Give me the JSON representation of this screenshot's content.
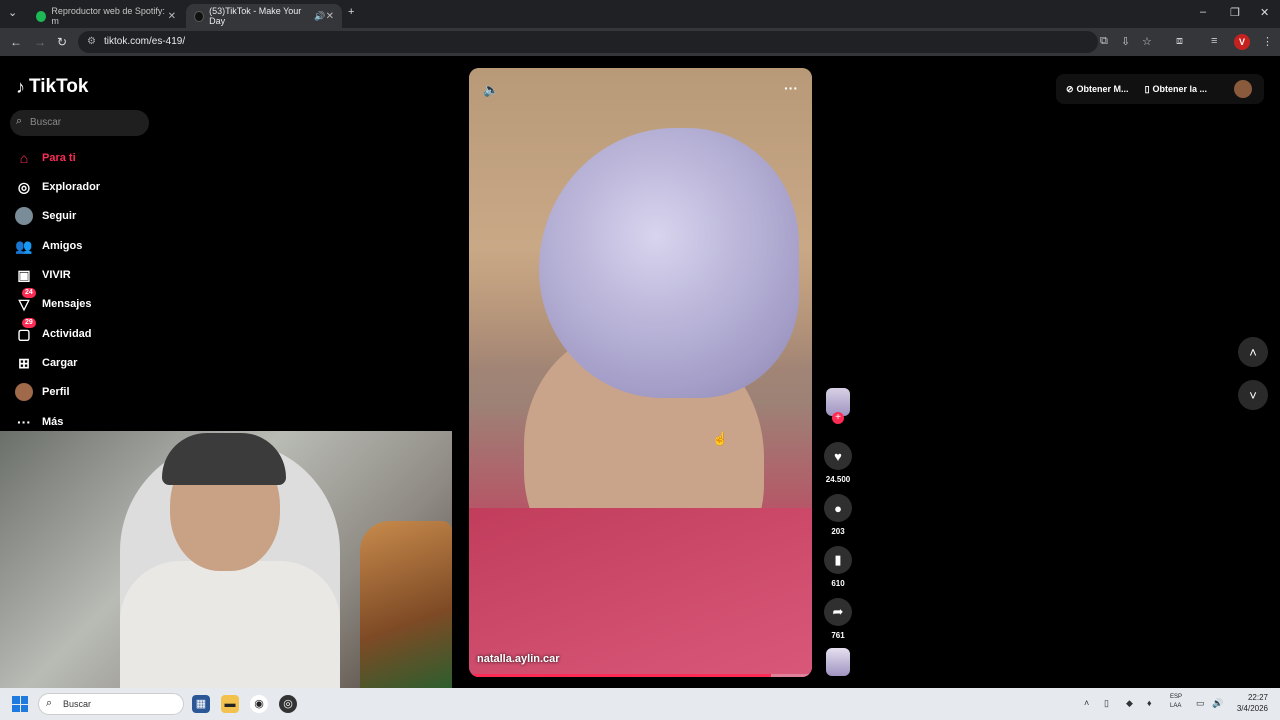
{
  "browser": {
    "tabs": [
      {
        "label": "Reproductor web de Spotify: m",
        "active": false
      },
      {
        "label": "(53)TikTok - Make Your Day",
        "active": true
      }
    ],
    "url": "tiktok.com/es-419/",
    "profile_letter": "V"
  },
  "tiktok": {
    "logo": "TikTok",
    "search_placeholder": "Buscar",
    "nav": [
      {
        "label": "Para ti",
        "icon": "home-icon",
        "active": true
      },
      {
        "label": "Explorador",
        "icon": "compass-icon"
      },
      {
        "label": "Seguir",
        "icon": "following-avatar-icon"
      },
      {
        "label": "Amigos",
        "icon": "friends-icon"
      },
      {
        "label": "VIVIR",
        "icon": "live-icon"
      },
      {
        "label": "Mensajes",
        "icon": "messages-icon",
        "badge": "24"
      },
      {
        "label": "Actividad",
        "icon": "activity-icon",
        "badge": "29"
      },
      {
        "label": "Cargar",
        "icon": "upload-icon"
      },
      {
        "label": "Perfil",
        "icon": "profile-avatar-icon"
      },
      {
        "label": "Más",
        "icon": "more-icon"
      }
    ],
    "video": {
      "username": "natalla.aylin.car",
      "progress": 0.88
    },
    "actions": {
      "likes": "24.500",
      "comments": "203",
      "saves": "610",
      "shares": "761"
    },
    "top_right": {
      "get_coins": "Obtener M...",
      "get_app": "Obtener la ..."
    }
  },
  "taskbar": {
    "search_placeholder": "Buscar",
    "lang_line1": "ESP",
    "lang_line2": "LAA",
    "time": "22:27",
    "date": "3/4/2026"
  },
  "colors": {
    "accent": "#fe2c55",
    "background": "#000000",
    "taskbar": "#e6e9ee"
  }
}
